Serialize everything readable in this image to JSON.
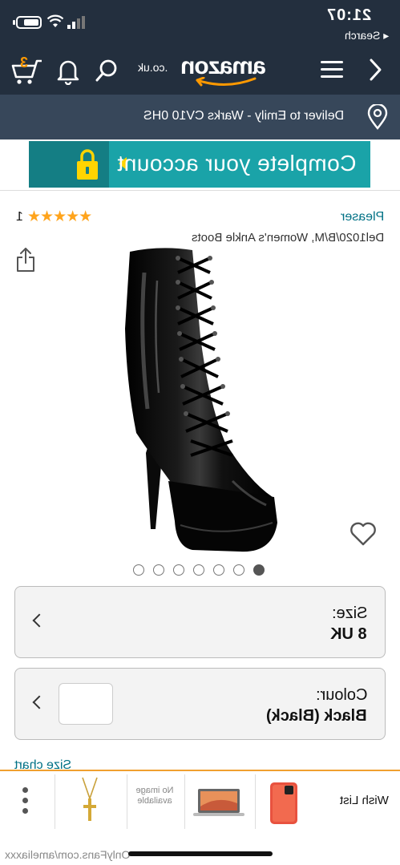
{
  "status_bar": {
    "time": "21:07",
    "back_label": "◂ Search"
  },
  "header": {
    "logo_word": "amazon",
    "logo_suffix": ".co.uk",
    "cart_count": "3"
  },
  "deliver": {
    "text": "Deliver to Emily - Warks CV10 0HS"
  },
  "banner": {
    "text": "Complete your account",
    "bg_color": "#1aa3a8",
    "arrow_color": "#ffd400"
  },
  "product": {
    "brand": "Pleaser",
    "stars": "★★★★★",
    "rating_count": "1",
    "title": "Del1020/B/M, Women's Ankle Boots",
    "image_count": 7,
    "active_image": 0
  },
  "size_selector": {
    "label": "Size:",
    "value": "8 UK"
  },
  "colour_selector": {
    "label": "Colour:",
    "value": "Black (Black)"
  },
  "size_chart_link": "Size chart",
  "bottom_bar": {
    "wish_list_label": "Wish List",
    "no_image_text": "No image available"
  },
  "watermark": "OnlyFans.com/ameliaxxx",
  "colors": {
    "header_bg": "#232f3e",
    "deliver_bg": "#37475a",
    "link": "#007185",
    "star": "#ffa41c",
    "accent_orange": "#ff9900"
  }
}
